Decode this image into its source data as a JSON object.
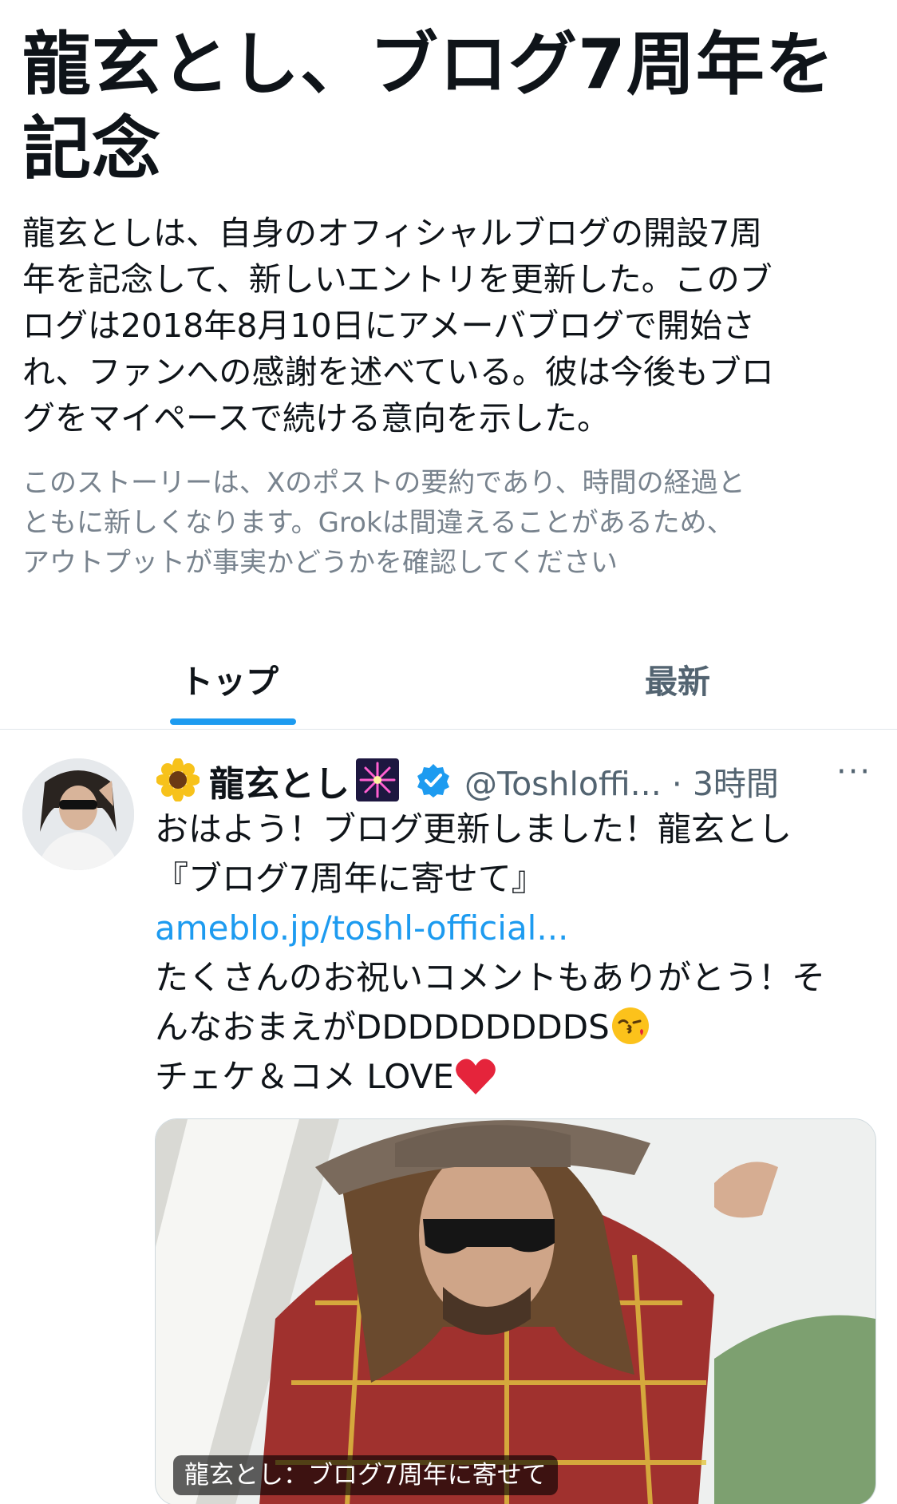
{
  "story": {
    "headline_line1": "龍玄とし、ブログ7周年を",
    "headline_line2": "記念",
    "summary_lines": [
      "龍玄としは、自身のオフィシャルブログの開設7周",
      "年を記念して、新しいエントリを更新した。このブ",
      "ログは2018年8月10日にアメーバブログで開始さ",
      "れ、ファンへの感謝を述べている。彼は今後もブロ",
      "グをマイペースで続ける意向を示した。"
    ],
    "disclaimer_lines": [
      "このストーリーは、Xのポストの要約であり、時間の経過と",
      "ともに新しくなります。Grokは間違えることがあるため、",
      "アウトプットが事実かどうかを確認してください"
    ]
  },
  "tabs": [
    {
      "label": "トップ",
      "active": true
    },
    {
      "label": "最新",
      "active": false
    }
  ],
  "tweet": {
    "display_name": "龍玄とし",
    "handle_time": "@Toshloffi... · 3時間",
    "more_label": "···",
    "body": {
      "line1": "おはよう！ブログ更新しました！龍玄とし",
      "line2": "『ブログ7周年に寄せて』",
      "link": "ameblo.jp/toshl-official...",
      "line4": "たくさんのお祝いコメントもありがとう！そ",
      "line5": "んなおまえがDDDDDDDDDS",
      "line6": "チェケ＆コメ LOVE"
    },
    "media_caption": "龍玄とし：ブログ7周年に寄せて"
  },
  "icons": {
    "name_prefix": "sunflower-emoji-icon",
    "name_suffix": "fireworks-emoji-icon",
    "verified": "verified-badge-icon",
    "kiss": "kissing-face-emoji-icon",
    "heart": "red-heart-emoji-icon"
  },
  "colors": {
    "accent": "#1d9bf0",
    "secondary_text": "#536471",
    "disclaimer_text": "#78838e"
  }
}
